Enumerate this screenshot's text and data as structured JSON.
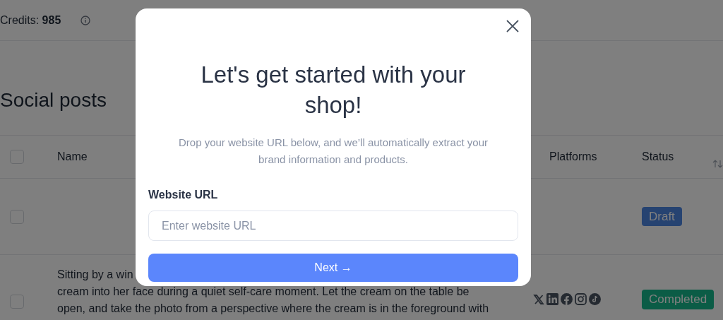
{
  "header": {
    "credits_label": "Credits:",
    "credits_value": "985"
  },
  "page_title": "Social posts",
  "table": {
    "select_all_checked": false,
    "columns": [
      {
        "label": "Name"
      },
      {
        "label": "Platforms"
      },
      {
        "label": "Status"
      }
    ],
    "rows": [
      {
        "checked": false,
        "name_lines": [],
        "platforms": [],
        "status": {
          "label": "Draft",
          "kind": "draft"
        }
      },
      {
        "checked": false,
        "name_lines": [
          "Sitting by a win",
          "cream into her face during a quiet self-care moment. Let the cream on the table be",
          "open, and take the photo from a perspective where the cream is in the foreground with"
        ],
        "platforms": [
          {
            "kind": "x"
          },
          {
            "kind": "linkedin"
          },
          {
            "kind": "facebook"
          },
          {
            "kind": "instagram"
          },
          {
            "kind": "tiktok"
          }
        ],
        "status": {
          "label": "Completed",
          "kind": "completed"
        }
      }
    ]
  },
  "dialog": {
    "title": "Let's get started with your shop!",
    "subtitle": "Drop your website URL below, and we’ll automatically extract your brand information and products.",
    "field_label": "Website URL",
    "field": {
      "placeholder": "Enter website URL"
    },
    "button": "Next →"
  }
}
